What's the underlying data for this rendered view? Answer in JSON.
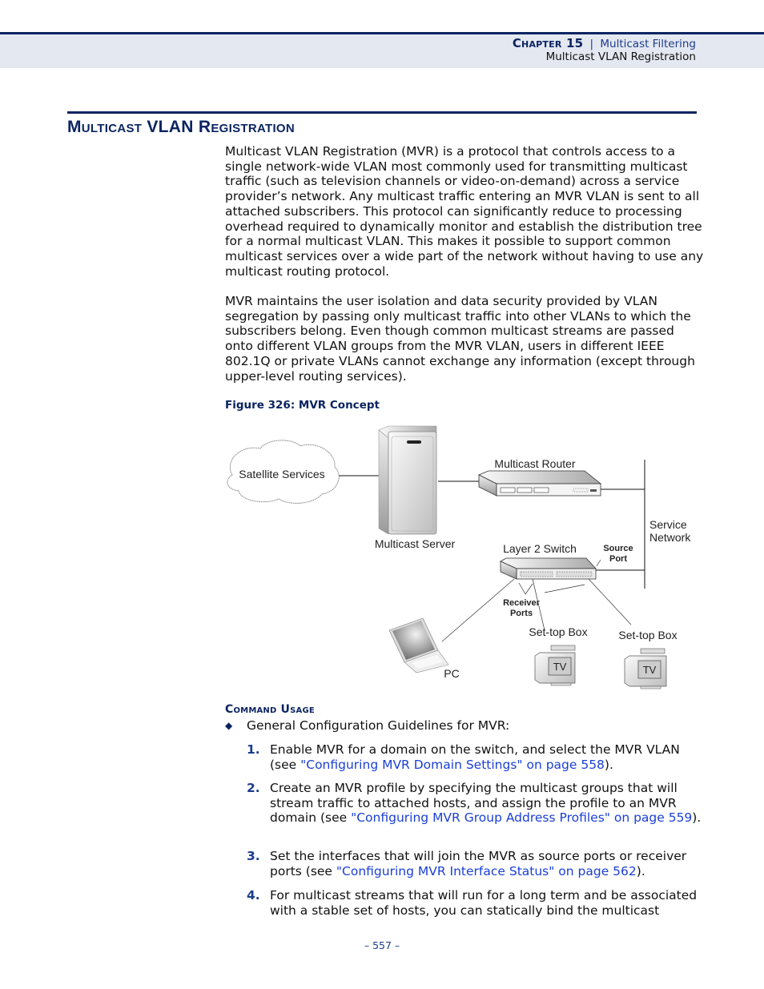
{
  "header": {
    "chapter": "Chapter 15",
    "separator": "|",
    "chapter_title": "Multicast Filtering",
    "section": "Multicast VLAN Registration"
  },
  "section": {
    "title": "Multicast VLAN Registration",
    "paragraphs": [
      "Multicast VLAN Registration (MVR) is a protocol that controls access to a single network-wide VLAN most commonly used for transmitting multicast traffic (such as television channels or video-on-demand) across a service provider’s network. Any multicast traffic entering an MVR VLAN is sent to all attached subscribers. This protocol can significantly reduce to processing overhead required to dynamically monitor and establish the distribution tree for a normal multicast VLAN. This makes it possible to support common multicast services over a wide part of the network without having to use any multicast routing protocol.",
      "MVR maintains the user isolation and data security provided by VLAN segregation by passing only multicast traffic into other VLANs to which the subscribers belong. Even though common multicast streams are passed onto different VLAN groups from the MVR VLAN, users in different IEEE 802.1Q or private VLANs cannot exchange any information (except through upper-level routing services)."
    ]
  },
  "figure": {
    "caption": "Figure 326:  MVR Concept",
    "labels": {
      "satellite": "Satellite Services",
      "server": "Multicast Server",
      "router": "Multicast Router",
      "service_line1": "Service",
      "service_line2": "Network",
      "switch": "Layer 2 Switch",
      "source_line1": "Source",
      "source_line2": "Port",
      "receiver_line1": "Receiver",
      "receiver_line2": "Ports",
      "stb1": "Set-top Box",
      "stb2": "Set-top Box",
      "tv1": "TV",
      "tv2": "TV",
      "pc": "PC"
    }
  },
  "command_usage": {
    "title": "Command Usage",
    "bullet_icon": "diamond-bullet-icon",
    "bullet": "General Configuration Guidelines for MVR:",
    "steps": [
      {
        "num": "1.",
        "pre": "Enable MVR for a domain on the switch, and select the MVR VLAN (see ",
        "link": "\"Configuring MVR Domain Settings\" on page 558",
        "post": ")."
      },
      {
        "num": "2.",
        "pre": "Create an MVR profile by specifying the multicast groups that will stream traffic to attached hosts, and assign the profile to an MVR domain (see ",
        "link": "\"Configuring MVR Group Address Profiles\" on page 559",
        "post": ")."
      },
      {
        "num": "3.",
        "pre": "Set the interfaces that will join the MVR as source ports or receiver ports (see ",
        "link": "\"Configuring MVR Interface Status\" on page 562",
        "post": ")."
      },
      {
        "num": "4.",
        "pre": "For multicast streams that will run for a long term and be associated with a stable set of hosts, you can statically bind the multicast",
        "link": "",
        "post": ""
      }
    ]
  },
  "footer": {
    "page": "–  557  –"
  }
}
